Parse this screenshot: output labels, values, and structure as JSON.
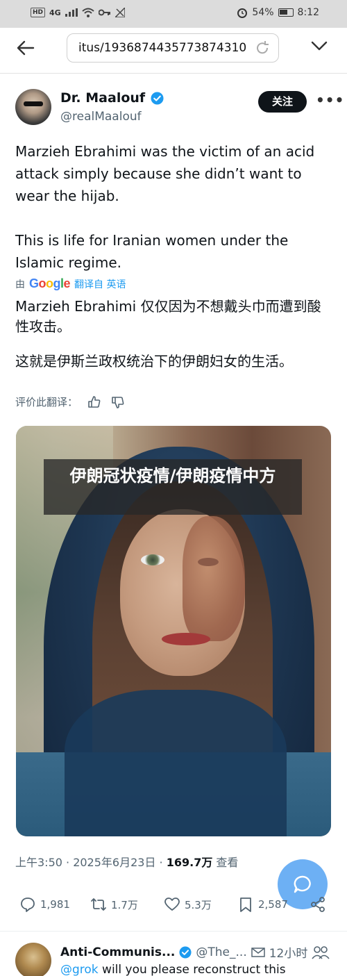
{
  "status_bar": {
    "left_badges": [
      "HD",
      "4G"
    ],
    "battery": "54%",
    "time": "8:12"
  },
  "browser": {
    "url": "itus/1936874435773874310"
  },
  "tweet": {
    "author_name": "Dr. Maalouf",
    "author_handle": "@realMaalouf",
    "follow_label": "关注",
    "text_p1": "Marzieh Ebrahimi was the victim of an acid attack simply because she didn’t want to wear the hijab.",
    "text_p2": "This is life for Iranian women under the Islamic regime.",
    "translated_by_prefix": "由",
    "translated_by_brand": "Google",
    "translated_by_suffix": "翻译自 英语",
    "translation_p1": "Marzieh Ebrahimi 仅仅因为不想戴头巾而遭到酸性攻击。",
    "translation_p2": "这就是伊斯兰政权统治下的伊朗妇女的生活。",
    "rate_label": "评价此翻译：",
    "overlay_caption": "伊朗冠状疫情/伊朗疫情中方",
    "timestamp": "上午3:50 · 2025年6月23日 · ",
    "views_count": "169.7万",
    "views_label": " 查看",
    "actions": {
      "replies": "1,981",
      "retweets": "1.7万",
      "likes": "5.3万",
      "bookmarks": "2,587"
    }
  },
  "reply": {
    "name": "Anti-Communis...",
    "handle": "@The_...",
    "time": "12小时",
    "mention": "@grok",
    "text": " will you please reconstruct this"
  },
  "colors": {
    "accent": "#1d9bf0",
    "text_primary": "#0f1419",
    "text_secondary": "#536471"
  }
}
